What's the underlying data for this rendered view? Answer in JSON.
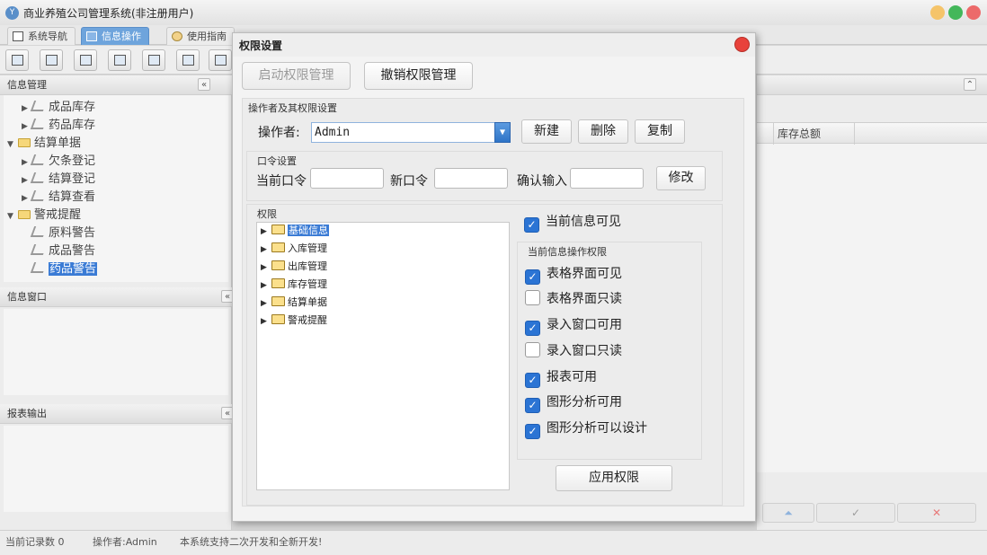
{
  "app": {
    "title": "商业养殖公司管理系统(非注册用户)",
    "logo_text": "Y"
  },
  "tabs": [
    {
      "label": "系统导航",
      "icon": "window-icon"
    },
    {
      "label": "信息操作",
      "icon": "grid-icon",
      "active": true
    },
    {
      "label": "使用指南",
      "icon": "globe-icon"
    }
  ],
  "left_panel": {
    "title": "信息管理",
    "collapse_glyph": "«",
    "tree": [
      {
        "label": "成品库存",
        "level": 1,
        "arrow": "▶"
      },
      {
        "label": "药品库存",
        "level": 1,
        "arrow": "▶"
      },
      {
        "label": "结算单据",
        "level": 0,
        "arrow": "▼"
      },
      {
        "label": "欠条登记",
        "level": 1,
        "arrow": "▶"
      },
      {
        "label": "结算登记",
        "level": 1,
        "arrow": "▶"
      },
      {
        "label": "结算查看",
        "level": 1,
        "arrow": "▶"
      },
      {
        "label": "警戒提醒",
        "level": 0,
        "arrow": "▼"
      },
      {
        "label": "原料警告",
        "level": 1,
        "arrow": ""
      },
      {
        "label": "成品警告",
        "level": 1,
        "arrow": ""
      },
      {
        "label": "药品警告",
        "level": 1,
        "arrow": "",
        "selected": true
      }
    ],
    "info_window": "信息窗口",
    "report_output": "报表输出",
    "expand_glyph": "«"
  },
  "right_panel": {
    "columns": [
      "",
      "库存总额"
    ],
    "nav": [
      "⏶",
      "✓",
      "✕"
    ],
    "expand_glyph": "⌃"
  },
  "status": {
    "records": "当前记录数 0",
    "operator": "操作者:Admin",
    "note": "本系统支持二次开发和全新开发!"
  },
  "dialog": {
    "title": "权限设置",
    "enable_btn": "启动权限管理",
    "revoke_btn": "撤销权限管理",
    "operator_group": "操作者及其权限设置",
    "operator_label": "操作者:",
    "operator_value": "Admin",
    "new_btn": "新建",
    "delete_btn": "删除",
    "copy_btn": "复制",
    "password_group": "口令设置",
    "current_pwd_label": "当前口令",
    "new_pwd_label": "新口令",
    "confirm_label": "确认输入",
    "modify_btn": "修改",
    "permissions_group": "权限",
    "perm_tree": [
      {
        "label": "基础信息",
        "selected": true
      },
      {
        "label": "入库管理"
      },
      {
        "label": "出库管理"
      },
      {
        "label": "库存管理"
      },
      {
        "label": "结算单据"
      },
      {
        "label": "警戒提醒"
      }
    ],
    "current_visible": {
      "label": "当前信息可见",
      "checked": true
    },
    "ops_group": "当前信息操作权限",
    "ops": [
      {
        "label": "表格界面可见",
        "checked": true
      },
      {
        "label": "表格界面只读",
        "checked": false
      },
      {
        "label": "录入窗口可用",
        "checked": true
      },
      {
        "label": "录入窗口只读",
        "checked": false
      },
      {
        "label": "报表可用",
        "checked": true
      },
      {
        "label": "图形分析可用",
        "checked": true
      },
      {
        "label": "图形分析可以设计",
        "checked": true
      }
    ],
    "apply_btn": "应用权限"
  }
}
